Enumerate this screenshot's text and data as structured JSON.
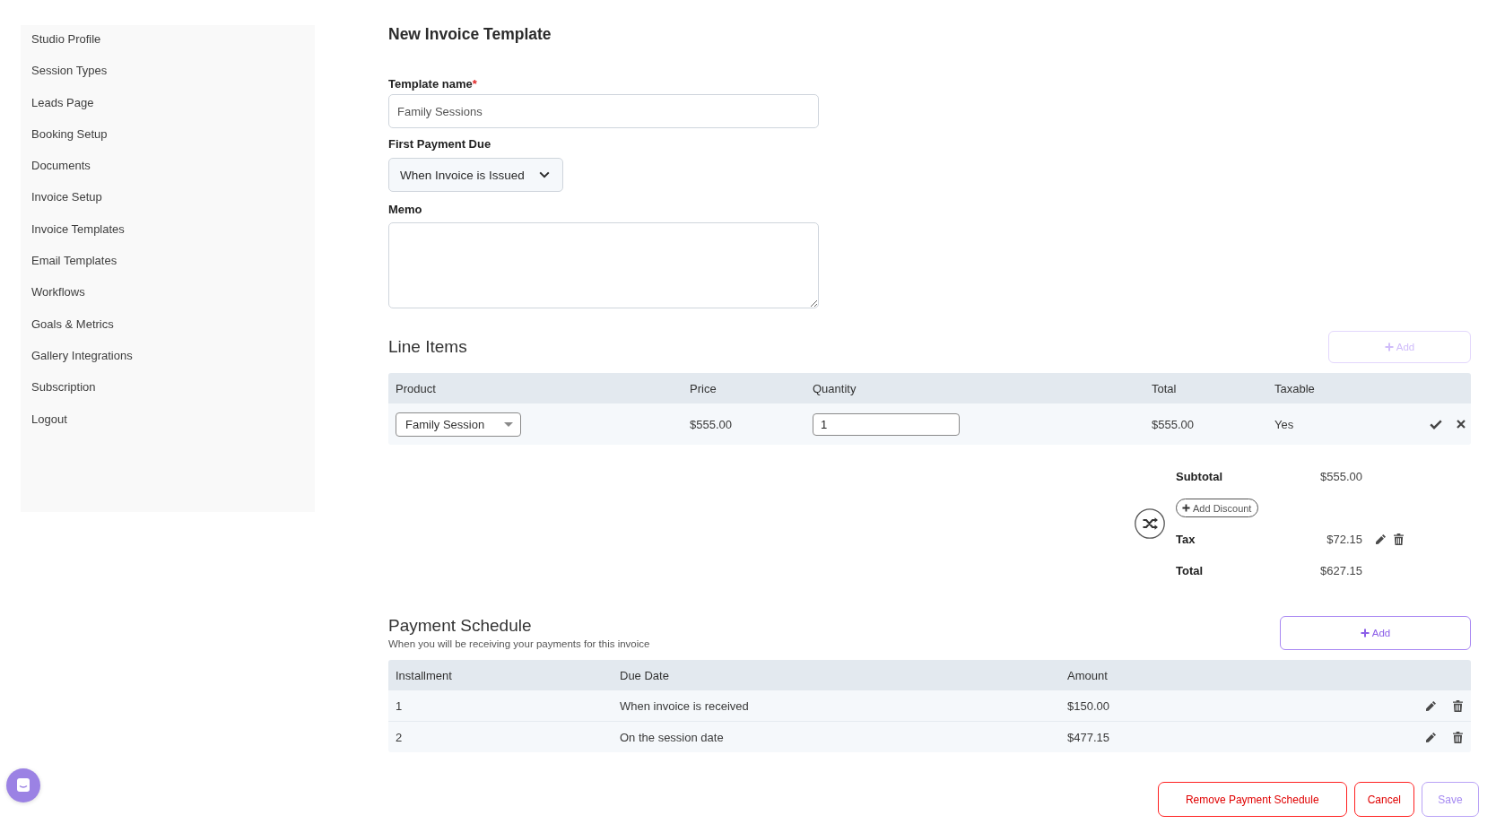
{
  "sidebar": {
    "items": [
      "Studio Profile",
      "Session Types",
      "Leads Page",
      "Booking Setup",
      "Documents",
      "Invoice Setup",
      "Invoice Templates",
      "Email Templates",
      "Workflows",
      "Goals & Metrics",
      "Gallery Integrations",
      "Subscription",
      "Logout"
    ]
  },
  "page": {
    "title": "New Invoice Template"
  },
  "form": {
    "template_name": {
      "label": "Template name",
      "required_mark": "*",
      "value": "Family Sessions"
    },
    "first_payment_due": {
      "label": "First Payment Due",
      "value": "When Invoice is Issued"
    },
    "memo": {
      "label": "Memo"
    }
  },
  "line_items": {
    "title": "Line Items",
    "add_button": {
      "label": "Add",
      "disabled": true
    },
    "columns": [
      "Product",
      "Price",
      "Quantity",
      "Total",
      "Taxable"
    ],
    "rows": [
      {
        "product": "Family Session",
        "price": "$555.00",
        "quantity": "1",
        "total": "$555.00",
        "taxable": "Yes"
      }
    ]
  },
  "summary": {
    "subtotal": {
      "label": "Subtotal",
      "value": "$555.00"
    },
    "discount_button": "Add Discount",
    "tax": {
      "label": "Tax",
      "value": "$72.15"
    },
    "total": {
      "label": "Total",
      "value": "$627.15"
    }
  },
  "payment_schedule": {
    "title": "Payment Schedule",
    "subtitle": "When you will be receiving your payments for this invoice",
    "add_button": {
      "label": "Add",
      "disabled": false
    },
    "columns": [
      "Installment",
      "Due Date",
      "Amount"
    ],
    "rows": [
      {
        "installment": "1",
        "due_date": "When invoice is received",
        "amount": "$150.00"
      },
      {
        "installment": "2",
        "due_date": "On the session date",
        "amount": "$477.15"
      }
    ]
  },
  "actions": [
    {
      "label": "Remove Payment Schedule",
      "kind": "remove"
    },
    {
      "label": "Cancel",
      "kind": "cancel"
    },
    {
      "label": "Save",
      "kind": "save"
    }
  ]
}
